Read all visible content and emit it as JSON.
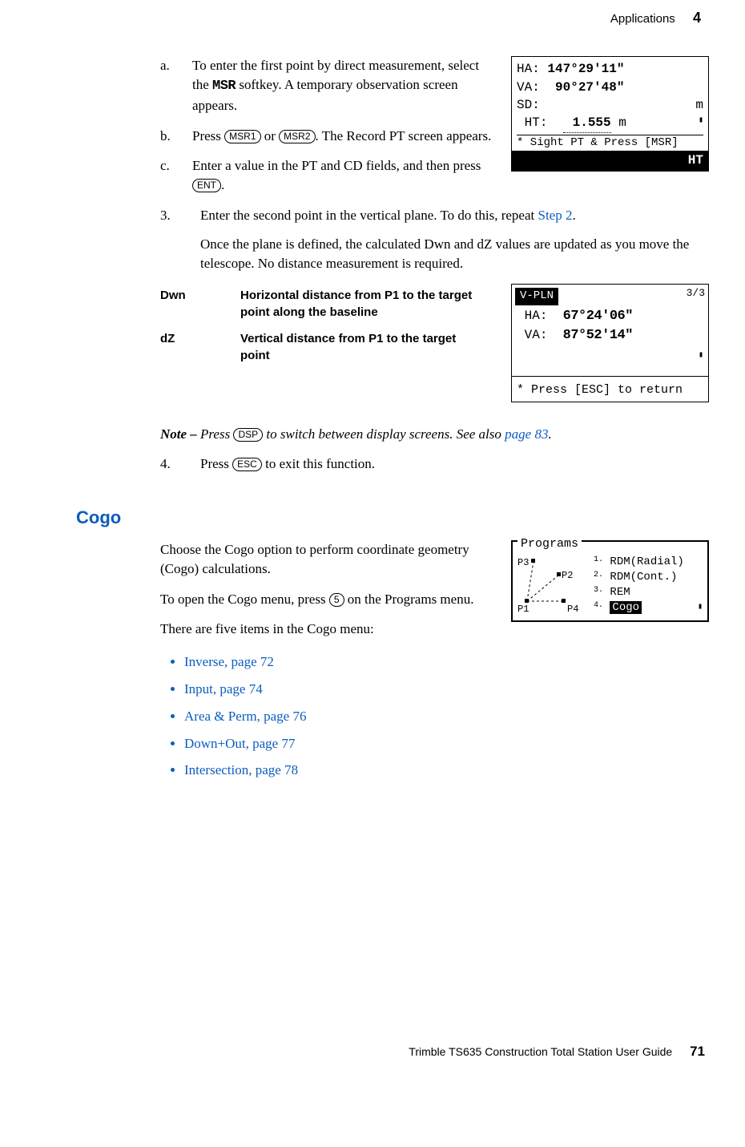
{
  "header": {
    "section": "Applications",
    "chapter": "4"
  },
  "steps_ab": {
    "a": {
      "letter": "a.",
      "pre": "To enter the first point by direct measurement, select the ",
      "key": "MSR",
      "post": " softkey. A temporary observation screen appears."
    },
    "b": {
      "letter": "b.",
      "pre": "Press ",
      "k1": "MSR1",
      "mid": " or ",
      "k2": "MSR2",
      "post": ". The Record PT screen appears."
    },
    "c": {
      "letter": "c.",
      "pre": "Enter a value in the PT and CD fields, and then press ",
      "k": "ENT",
      "post": "."
    }
  },
  "screen1": {
    "ha_label": "HA:",
    "ha_val": "147°29'11\"",
    "va_label": "VA:",
    "va_val": "90°27'48\"",
    "sd_label": "SD:",
    "sd_unit": "m",
    "ht_label": "HT:",
    "ht_val": "1.555",
    "ht_unit": "m",
    "hint": "* Sight PT & Press [MSR]",
    "soft": "HT"
  },
  "step3": {
    "num": "3.",
    "line": "Enter the second point in the vertical plane. To do this, repeat ",
    "link": "Step 2",
    "after": ".",
    "para": "Once the plane is defined, the calculated Dwn and dZ values are updated as you move the telescope. No distance measurement is required."
  },
  "defs": {
    "r1": {
      "term": "Dwn",
      "desc": "Horizontal distance from P1 to the target point along the baseline"
    },
    "r2": {
      "term": "dZ",
      "desc": "Vertical distance from P1 to the target point"
    }
  },
  "screen2": {
    "tab": "V-PLN",
    "page": "3/3",
    "ha_label": "HA:",
    "ha_val": "67°24'06\"",
    "va_label": "VA:",
    "va_val": "87°52'14\"",
    "foot": "* Press [ESC] to return"
  },
  "note": {
    "lead": "Note – ",
    "pre": "Press ",
    "key": "DSP",
    "mid": " to switch between display screens. See also ",
    "link": "page 83",
    "end": "."
  },
  "step4": {
    "num": "4.",
    "pre": "Press ",
    "key": "ESC",
    "post": " to exit this function."
  },
  "cogo": {
    "heading": "Cogo",
    "p1": "Choose the Cogo option to perform coordinate geometry (Cogo) calculations.",
    "p2_pre": "To open the Cogo menu, press ",
    "p2_key": "5",
    "p2_post": " on the Programs menu.",
    "p3": "There are five items in the Cogo menu:",
    "items": [
      "Inverse, page 72",
      "Input, page 74",
      "Area & Perm, page 76",
      "Down+Out, page 77",
      "Intersection, page 78"
    ]
  },
  "screen3": {
    "title": "Programs",
    "labels": {
      "p1": "P1",
      "p2": "P2",
      "p3": "P3",
      "p4": "P4"
    },
    "menu": [
      {
        "n": "1.",
        "t": "RDM(Radial)"
      },
      {
        "n": "2.",
        "t": "RDM(Cont.)"
      },
      {
        "n": "3.",
        "t": "REM"
      },
      {
        "n": "4.",
        "t": "Cogo"
      }
    ]
  },
  "footer": {
    "title": "Trimble TS635 Construction Total Station User Guide",
    "page": "71"
  }
}
